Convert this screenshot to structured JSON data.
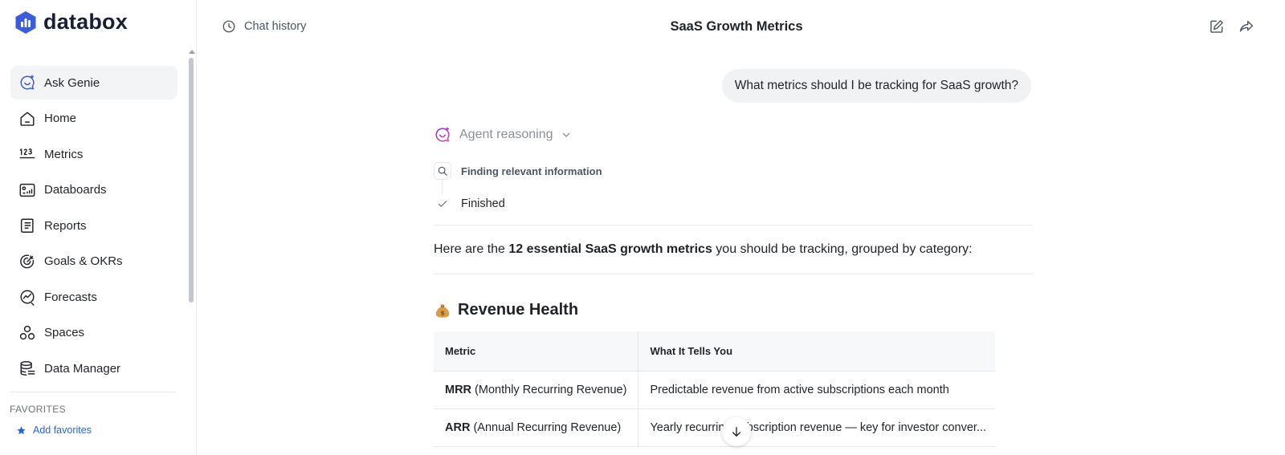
{
  "brand": {
    "name": "databox",
    "color": "#3b5bdb"
  },
  "sidebar": {
    "items": [
      {
        "label": "Ask Genie",
        "icon": "genie-icon",
        "active": true
      },
      {
        "label": "Home",
        "icon": "home-icon"
      },
      {
        "label": "Metrics",
        "icon": "metrics-123-icon"
      },
      {
        "label": "Databoards",
        "icon": "databoards-icon"
      },
      {
        "label": "Reports",
        "icon": "reports-icon"
      },
      {
        "label": "Goals & OKRs",
        "icon": "target-icon"
      },
      {
        "label": "Forecasts",
        "icon": "forecast-icon"
      },
      {
        "label": "Spaces",
        "icon": "spaces-icon"
      },
      {
        "label": "Data Manager",
        "icon": "database-icon"
      }
    ],
    "favorites_title": "FAVORITES",
    "add_favorites": "Add favorites"
  },
  "header": {
    "history_label": "Chat history",
    "title": "SaaS Growth Metrics"
  },
  "chat": {
    "user_message": "What metrics should I be tracking for SaaS growth?",
    "reasoning_label": "Agent reasoning",
    "steps": [
      {
        "label": "Finding relevant information",
        "icon": "search-icon"
      },
      {
        "label": "Finished",
        "icon": "check-icon"
      }
    ],
    "intro_before": "Here are the ",
    "intro_bold": "12 essential SaaS growth metrics",
    "intro_after": " you should be tracking, grouped by category:",
    "section_emoji": "money-bag-icon",
    "section_title": "Revenue Health",
    "table": {
      "headers": [
        "Metric",
        "What It Tells You"
      ],
      "rows": [
        {
          "metric_bold": "MRR",
          "metric_rest": " (Monthly Recurring Revenue)",
          "desc": "Predictable revenue from active subscriptions each month"
        },
        {
          "metric_bold": "ARR",
          "metric_rest": " (Annual Recurring Revenue)",
          "desc": "Yearly recurring subscription revenue — key for investor conver..."
        }
      ]
    }
  }
}
